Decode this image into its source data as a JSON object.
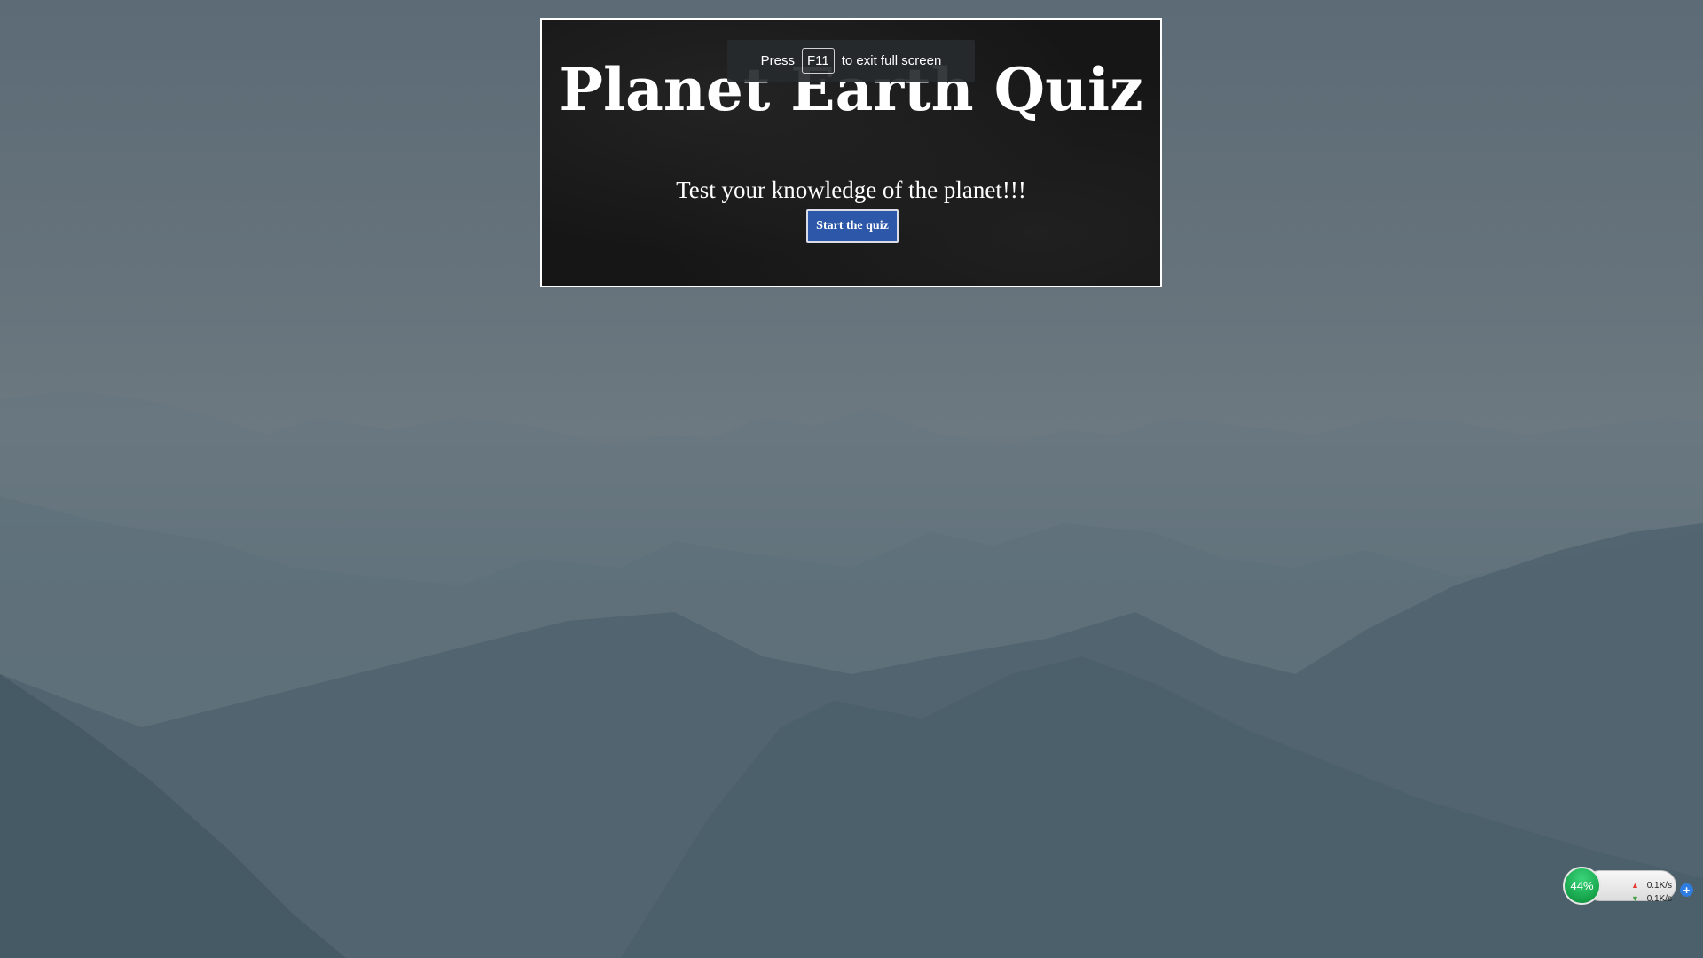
{
  "colors": {
    "card_background": "#161616",
    "card_border": "#ffffff",
    "button_background": "#2d57a8",
    "net_indicator": "#16a34a",
    "net_plus": "#2f7de1"
  },
  "quiz": {
    "title": "Planet Earth Quiz",
    "subtitle": "Test your knowledge of the planet!!!",
    "start_button_label": "Start the quiz"
  },
  "fullscreen_notice": {
    "prefix": "Press",
    "key": "F11",
    "suffix": "to exit full screen"
  },
  "network_widget": {
    "percent": "44%",
    "upload_rate": "0.1K/s",
    "download_rate": "0.1K/s",
    "icons": [
      "arrow-up-icon",
      "arrow-down-icon",
      "plus-icon"
    ]
  }
}
